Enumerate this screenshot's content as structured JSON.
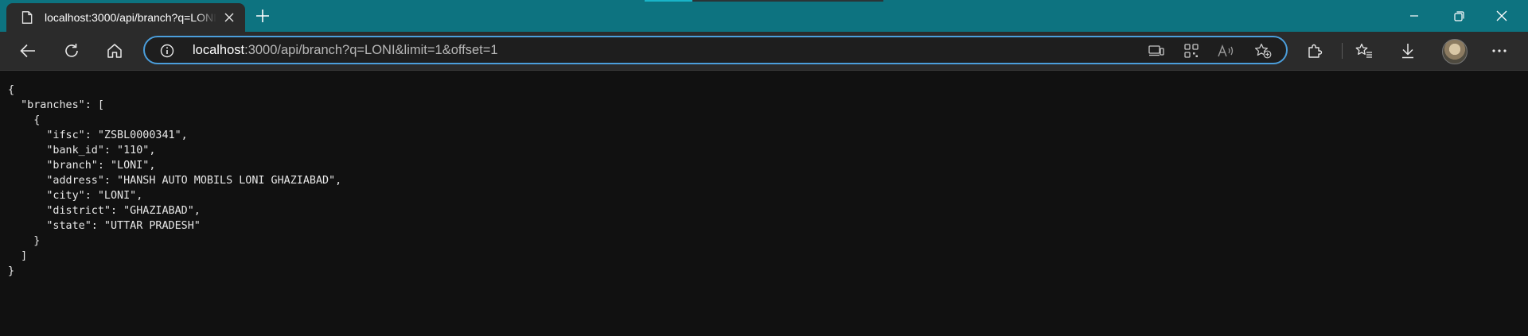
{
  "tab": {
    "title": "localhost:3000/api/branch?q=LONI&limit=1&offset=1",
    "icon": "page-icon"
  },
  "address": {
    "host": "localhost",
    "rest": ":3000/api/branch?q=LONI&limit=1&offset=1"
  },
  "colors": {
    "titlebar": "#0d7380",
    "toolbar": "#2b2b2b",
    "content_bg": "#111111",
    "address_border": "#4b9edb"
  },
  "json_lines": [
    {
      "text": "{"
    },
    {
      "text": "  \"branches\": ["
    },
    {
      "text": "    {"
    },
    {
      "text": "      \"ifsc\": \"ZSBL0000341\","
    },
    {
      "text": "      \"bank_id\": \"110\","
    },
    {
      "text": "      \"branch\": \"LONI\","
    },
    {
      "text": "      \"address\": \"HANSH AUTO MOBILS LONI GHAZIABAD\","
    },
    {
      "text": "      \"city\": \"LONI\","
    },
    {
      "text": "      \"district\": \"GHAZIABAD\","
    },
    {
      "text": "      \"state\": \"UTTAR PRADESH\""
    },
    {
      "text": "    }"
    },
    {
      "text": "  ]"
    },
    {
      "text": "}"
    }
  ]
}
